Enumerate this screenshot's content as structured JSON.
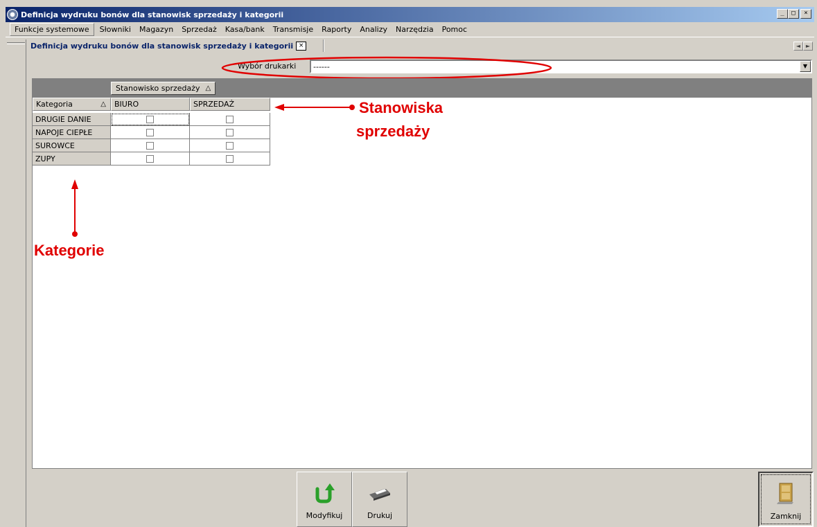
{
  "window": {
    "title": "Definicja wydruku bonów dla stanowisk sprzedaży i kategorii",
    "controls": {
      "minimize": "_",
      "maximize": "□",
      "close": "×"
    }
  },
  "menu": [
    "Funkcje systemowe",
    "Słowniki",
    "Magazyn",
    "Sprzedaż",
    "Kasa/bank",
    "Transmisje",
    "Raporty",
    "Analizy",
    "Narzędzia",
    "Pomoc"
  ],
  "document_tab": {
    "label": "Definicja wydruku bonów dla stanowisk sprzedaży i kategorii",
    "close": "×"
  },
  "tab_scroll": {
    "left": "◄",
    "right": "►"
  },
  "printer": {
    "label": "Wybór drukarki",
    "value": "------",
    "arrow": "▼"
  },
  "grid": {
    "group_by": "Stanowisko sprzedaży",
    "sort_icon": "△",
    "row_header": "Kategoria",
    "columns": [
      "BIURO",
      "SPRZEDAŻ"
    ],
    "rows": [
      {
        "label": "DRUGIE DANIE",
        "checked": [
          false,
          false
        ]
      },
      {
        "label": "NAPOJE CIEPŁE",
        "checked": [
          false,
          false
        ]
      },
      {
        "label": "SUROWCE",
        "checked": [
          false,
          false
        ]
      },
      {
        "label": "ZUPY",
        "checked": [
          false,
          false
        ]
      }
    ]
  },
  "annotations": {
    "stations_line1": "Stanowiska",
    "stations_line2": "sprzedaży",
    "categories": "Kategorie",
    "color": "#e00000"
  },
  "toolbar": {
    "modify_label": "Modyfikuj",
    "print_label": "Drukuj",
    "close_label": "Zamknij"
  }
}
